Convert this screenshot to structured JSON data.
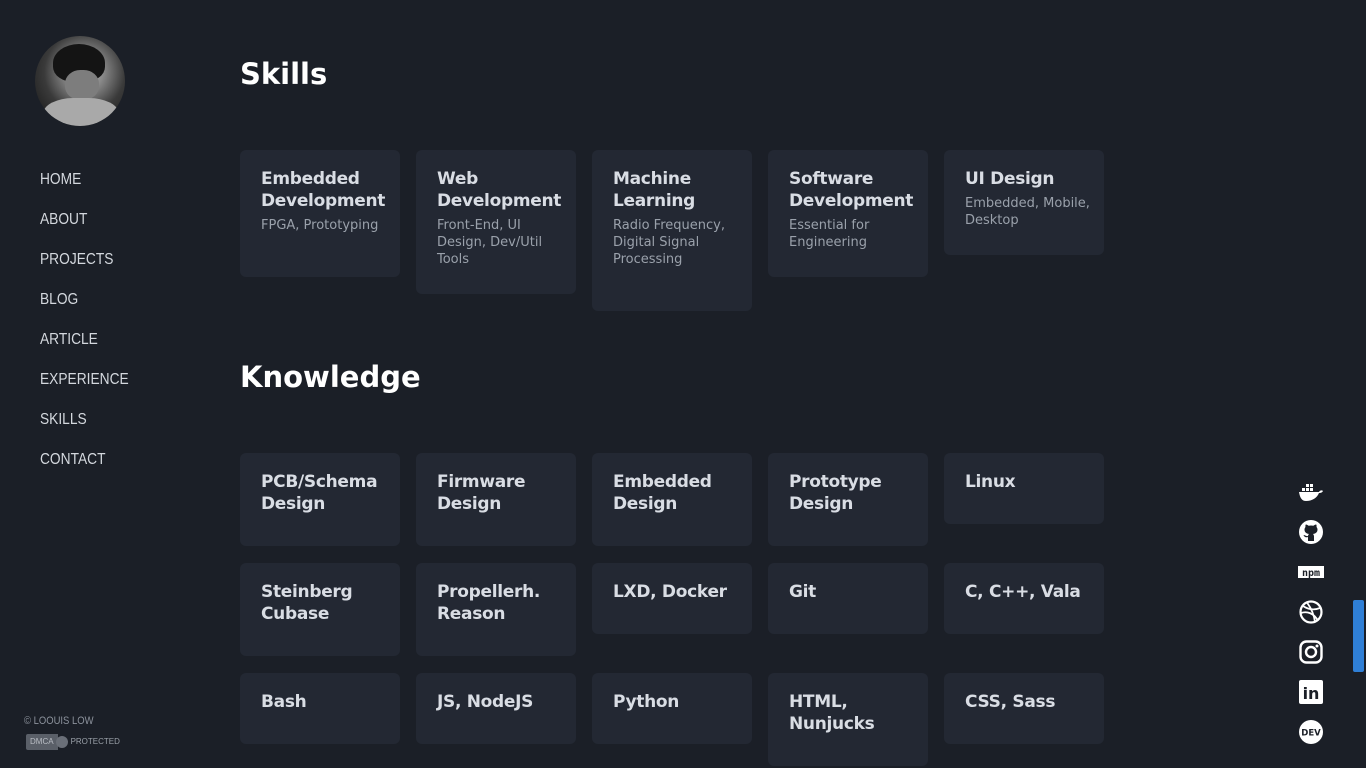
{
  "nav": {
    "items": [
      "HOME",
      "ABOUT",
      "PROJECTS",
      "BLOG",
      "ARTICLE",
      "EXPERIENCE",
      "SKILLS",
      "CONTACT"
    ]
  },
  "footer": {
    "copyright": "© LOOUIS LOW",
    "dmca_left": "DMCA",
    "dmca_right": "PROTECTED"
  },
  "skills": {
    "heading": "Skills",
    "cards": [
      {
        "title": "Embedded Development",
        "desc": "FPGA, Prototyping"
      },
      {
        "title": "Web Development",
        "desc": "Front-End, UI Design, Dev/Util Tools"
      },
      {
        "title": "Machine Learning",
        "desc": "Radio Frequency, Digital Signal Processing"
      },
      {
        "title": "Software Development",
        "desc": "Essential for Engineering"
      },
      {
        "title": "UI Design",
        "desc": "Embedded, Mobile, Desktop"
      }
    ]
  },
  "knowledge": {
    "heading": "Knowledge",
    "cards": [
      {
        "title": "PCB/Schema Design"
      },
      {
        "title": "Firmware Design"
      },
      {
        "title": "Embedded Design"
      },
      {
        "title": "Prototype Design"
      },
      {
        "title": "Linux"
      },
      {
        "title": "Steinberg Cubase"
      },
      {
        "title": "Propellerh. Reason"
      },
      {
        "title": "LXD, Docker"
      },
      {
        "title": "Git"
      },
      {
        "title": "C, C++, Vala"
      },
      {
        "title": "Bash"
      },
      {
        "title": "JS, NodeJS"
      },
      {
        "title": "Python"
      },
      {
        "title": "HTML, Nunjucks"
      },
      {
        "title": "CSS, Sass"
      }
    ]
  },
  "social": {
    "icons": [
      "docker-icon",
      "github-icon",
      "npm-icon",
      "dribbble-icon",
      "instagram-icon",
      "linkedin-icon",
      "dev-icon"
    ],
    "npm_label": "npm",
    "linkedin_label": "in",
    "dev_label": "DEV"
  }
}
